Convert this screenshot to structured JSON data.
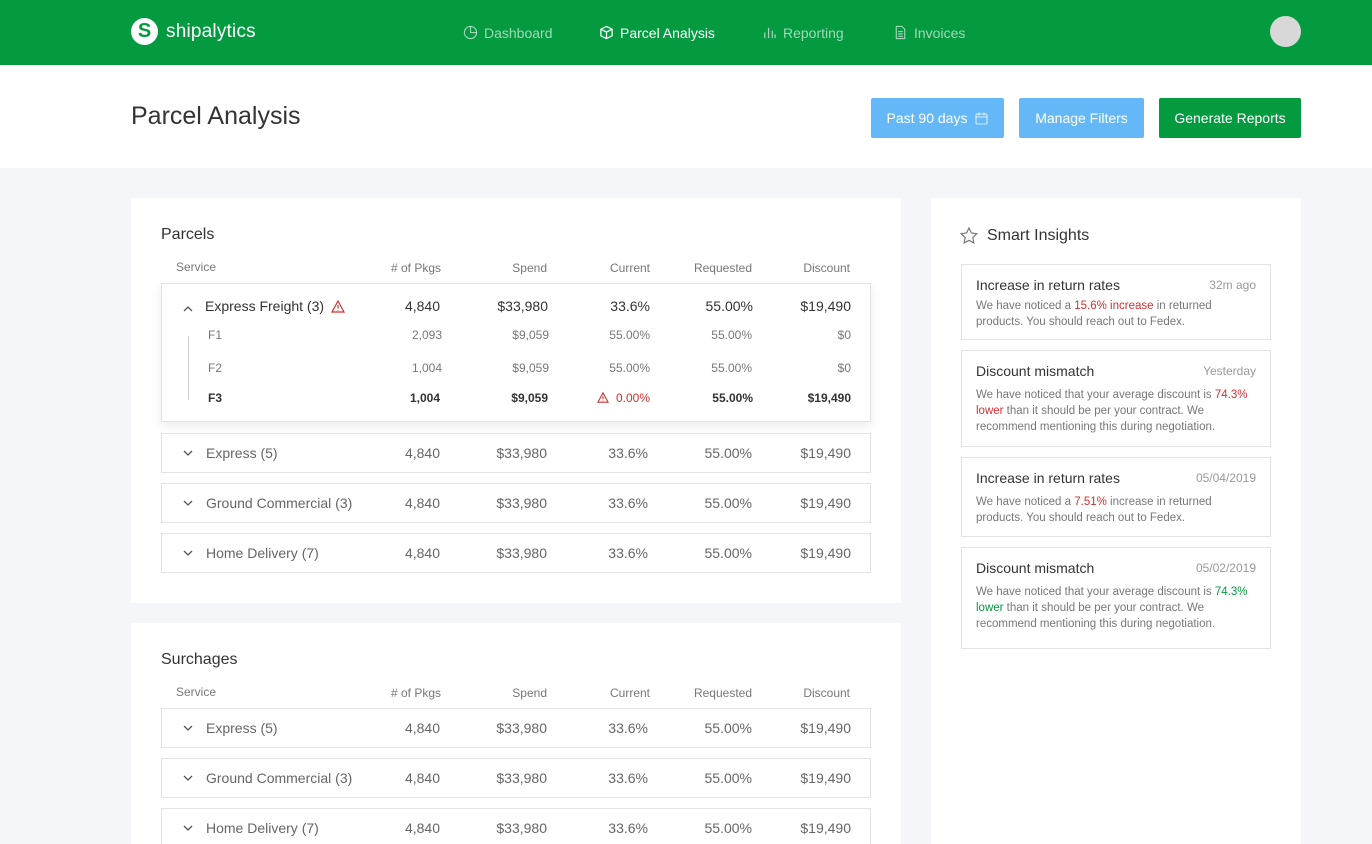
{
  "app": {
    "name": "shipalytics"
  },
  "nav": [
    {
      "label": "Dashboard",
      "icon": "pie-chart-icon",
      "active": false
    },
    {
      "label": "Parcel Analysis",
      "icon": "box-icon",
      "active": true
    },
    {
      "label": "Reporting",
      "icon": "bar-chart-icon",
      "active": false
    },
    {
      "label": "Invoices",
      "icon": "document-icon",
      "active": false
    }
  ],
  "page": {
    "title": "Parcel Analysis",
    "date_range_label": "Past 90 days",
    "manage_filters_label": "Manage Filters",
    "generate_reports_label": "Generate Reports"
  },
  "columns": [
    "Service",
    "# of Pkgs",
    "Spend",
    "Current",
    "Requested",
    "Discount"
  ],
  "parcels": {
    "title": "Parcels",
    "expanded": {
      "name": "Express Freight (3)",
      "warning": true,
      "pkgs": "4,840",
      "spend": "$33,980",
      "current": "33.6%",
      "requested": "55.00%",
      "discount": "$19,490",
      "sub": [
        {
          "name": "F1",
          "pkgs": "2,093",
          "spend": "$9,059",
          "current": "55.00%",
          "requested": "55.00%",
          "discount": "$0"
        },
        {
          "name": "F2",
          "pkgs": "1,004",
          "spend": "$9,059",
          "current": "55.00%",
          "requested": "55.00%",
          "discount": "$0"
        },
        {
          "name": "F3",
          "pkgs": "1,004",
          "spend": "$9,059",
          "current": "0.00%",
          "requested": "55.00%",
          "discount": "$19,490"
        }
      ]
    },
    "rows": [
      {
        "name": "Express (5)",
        "pkgs": "4,840",
        "spend": "$33,980",
        "current": "33.6%",
        "requested": "55.00%",
        "discount": "$19,490"
      },
      {
        "name": "Ground Commercial (3)",
        "pkgs": "4,840",
        "spend": "$33,980",
        "current": "33.6%",
        "requested": "55.00%",
        "discount": "$19,490"
      },
      {
        "name": "Home Delivery (7)",
        "pkgs": "4,840",
        "spend": "$33,980",
        "current": "33.6%",
        "requested": "55.00%",
        "discount": "$19,490"
      }
    ]
  },
  "surcharges": {
    "title": "Surchages",
    "rows": [
      {
        "name": "Express (5)",
        "pkgs": "4,840",
        "spend": "$33,980",
        "current": "33.6%",
        "requested": "55.00%",
        "discount": "$19,490"
      },
      {
        "name": "Ground Commercial (3)",
        "pkgs": "4,840",
        "spend": "$33,980",
        "current": "33.6%",
        "requested": "55.00%",
        "discount": "$19,490"
      },
      {
        "name": "Home Delivery (7)",
        "pkgs": "4,840",
        "spend": "$33,980",
        "current": "33.6%",
        "requested": "55.00%",
        "discount": "$19,490"
      }
    ]
  },
  "insights": {
    "title": "Smart Insights",
    "items": [
      {
        "title": "Increase in return rates",
        "time": "32m ago",
        "pre": "We have noticed a ",
        "highlight": "15.6% increase",
        "post": " in returned products. You should reach out to Fedex.",
        "color": "red"
      },
      {
        "title": "Discount mismatch",
        "time": "Yesterday",
        "pre": "We have noticed that your average discount is ",
        "highlight": "74.3% lower",
        "post": " than it should be per your contract. We recommend mentioning this during negotiation.",
        "color": "red"
      },
      {
        "title": "Increase in return rates",
        "time": "05/04/2019",
        "pre": "We have noticed a ",
        "highlight": "7.51%",
        "post": " increase in returned products. You should reach out to Fedex.",
        "color": "red"
      },
      {
        "title": "Discount mismatch",
        "time": "05/02/2019",
        "pre": "We have noticed that your average discount is ",
        "highlight": "74.3% lower",
        "post": " than it should be per your contract. We recommend mentioning this during negotiation.",
        "color": "green"
      }
    ]
  },
  "colors": {
    "brand": "#039a40",
    "accent": "#64b8f7",
    "warning": "#d32f2f"
  }
}
